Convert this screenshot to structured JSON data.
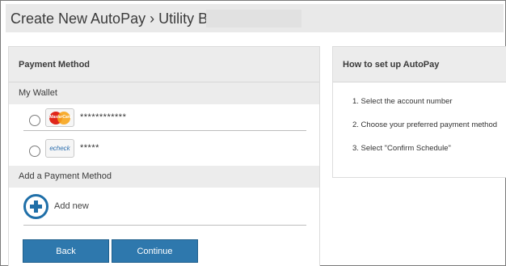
{
  "header": {
    "title": "Create New AutoPay › Utility Bill #"
  },
  "payment": {
    "heading": "Payment Method",
    "wallet_heading": "My Wallet",
    "wallet": [
      {
        "logo_text": "MasterCard",
        "masked": "************"
      },
      {
        "logo_text": "echeck",
        "masked": "*****"
      }
    ],
    "add_heading": "Add a Payment Method",
    "add_label": "Add new"
  },
  "buttons": {
    "back": "Back",
    "continue": "Continue"
  },
  "howto": {
    "heading": "How to set up AutoPay",
    "steps": [
      "1. Select the account number",
      "2. Choose your preferred payment method",
      "3. Select \"Confirm Schedule\""
    ]
  },
  "colors": {
    "accent": "#2e78ad",
    "panel_header": "#ececec",
    "add_icon": "#1f6fa8"
  }
}
